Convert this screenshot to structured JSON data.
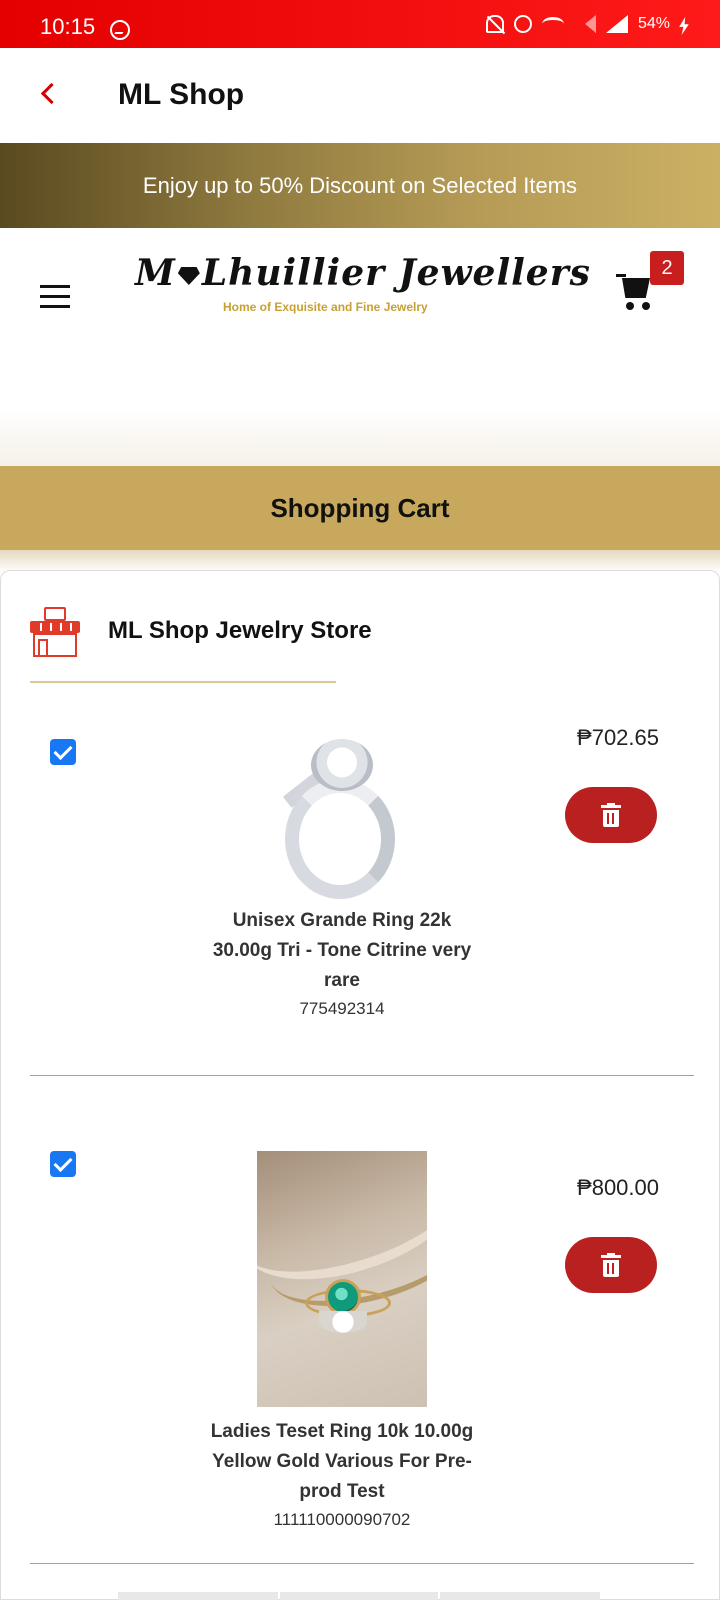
{
  "status_bar": {
    "time": "10:15",
    "battery": "54%",
    "icons": [
      "messenger-icon",
      "mute-icon",
      "alarm-icon",
      "wifi-icon",
      "signal-icon",
      "signal-icon",
      "charging-icon"
    ]
  },
  "app_bar": {
    "title": "ML Shop",
    "back_icon": "chevron-left-icon"
  },
  "promo": {
    "text": "Enjoy up to 50% Discount on Selected Items"
  },
  "header": {
    "logo_text": "M  Lhuillier Jewellers",
    "logo_tagline": "Home of Exquisite and Fine Jewelry",
    "cart_count": "2"
  },
  "cart": {
    "title": "Shopping Cart",
    "store_name": "ML Shop Jewelry Store",
    "items": [
      {
        "name": "Unisex Grande Ring 22k 30.00g Tri - Tone Citrine very rare",
        "sku": "775492314",
        "price": "₱702.65",
        "checked": true
      },
      {
        "name": "Ladies Teset Ring 10k 10.00g Yellow Gold Various For Pre-prod Test",
        "sku": "111110000090702",
        "price": "₱800.00",
        "checked": true
      }
    ]
  },
  "colors": {
    "status_bar": "#e40000",
    "accent_red": "#b8211f",
    "gold": "#c7a85c",
    "checkbox_blue": "#1877f2"
  }
}
